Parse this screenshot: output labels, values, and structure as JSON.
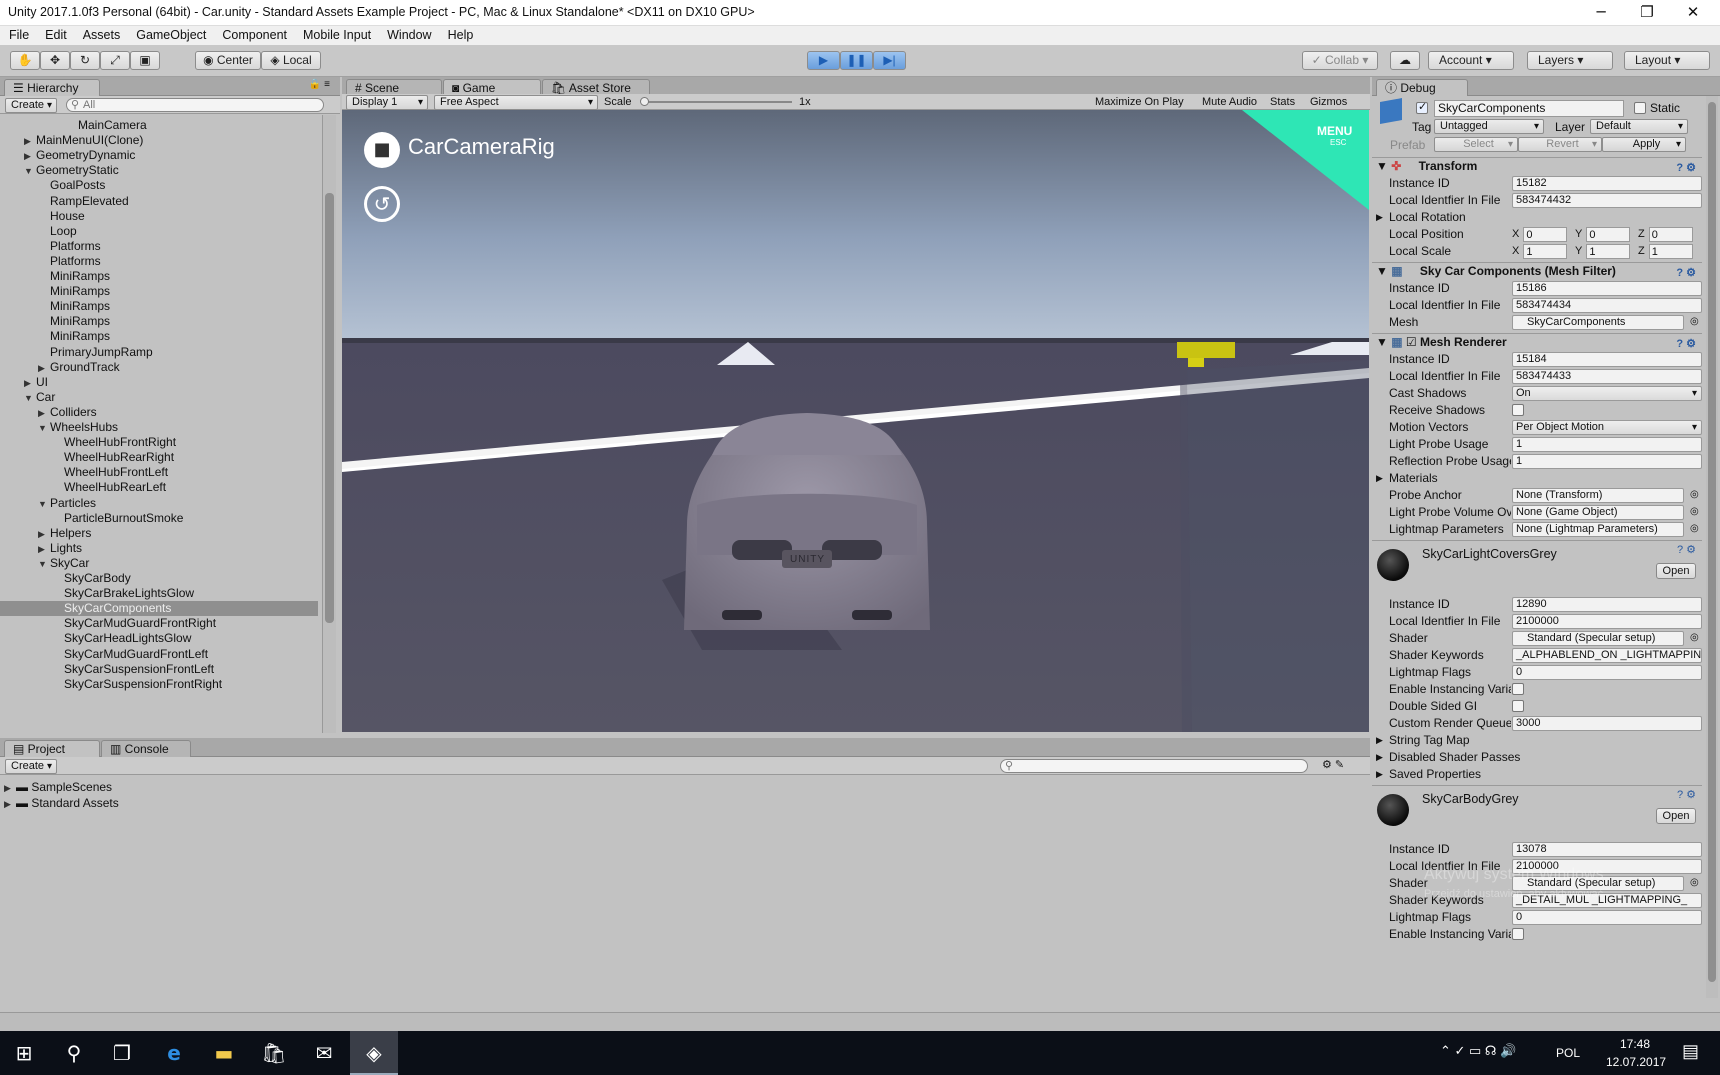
{
  "window": {
    "title": "Unity 2017.1.0f3 Personal (64bit) - Car.unity - Standard Assets Example Project - PC, Mac & Linux Standalone* <DX11 on DX10 GPU>",
    "minimize": "─",
    "maximize": "❐",
    "close": "✕"
  },
  "menu": [
    "File",
    "Edit",
    "Assets",
    "GameObject",
    "Component",
    "Mobile Input",
    "Window",
    "Help"
  ],
  "toolbar": {
    "center": "Center",
    "local": "Local",
    "collab": "Collab",
    "account": "Account",
    "layers": "Layers",
    "layout": "Layout"
  },
  "hierarchy": {
    "tab": "Hierarchy",
    "create": "Create",
    "search_placeholder": "All",
    "rows": [
      {
        "t": "MainCamera",
        "d": 4,
        "a": ""
      },
      {
        "t": "MainMenuUI(Clone)",
        "d": 1,
        "a": "▶"
      },
      {
        "t": "GeometryDynamic",
        "d": 1,
        "a": "▶"
      },
      {
        "t": "GeometryStatic",
        "d": 1,
        "a": "▼"
      },
      {
        "t": "GoalPosts",
        "d": 2,
        "a": ""
      },
      {
        "t": "RampElevated",
        "d": 2,
        "a": ""
      },
      {
        "t": "House",
        "d": 2,
        "a": ""
      },
      {
        "t": "Loop",
        "d": 2,
        "a": ""
      },
      {
        "t": "Platforms",
        "d": 2,
        "a": ""
      },
      {
        "t": "Platforms",
        "d": 2,
        "a": ""
      },
      {
        "t": "MiniRamps",
        "d": 2,
        "a": ""
      },
      {
        "t": "MiniRamps",
        "d": 2,
        "a": ""
      },
      {
        "t": "MiniRamps",
        "d": 2,
        "a": ""
      },
      {
        "t": "MiniRamps",
        "d": 2,
        "a": ""
      },
      {
        "t": "MiniRamps",
        "d": 2,
        "a": ""
      },
      {
        "t": "PrimaryJumpRamp",
        "d": 2,
        "a": ""
      },
      {
        "t": "GroundTrack",
        "d": 2,
        "a": "▶"
      },
      {
        "t": "UI",
        "d": 1,
        "a": "▶"
      },
      {
        "t": "Car",
        "d": 1,
        "a": "▼"
      },
      {
        "t": "Colliders",
        "d": 2,
        "a": "▶"
      },
      {
        "t": "WheelsHubs",
        "d": 2,
        "a": "▼"
      },
      {
        "t": "WheelHubFrontRight",
        "d": 3,
        "a": ""
      },
      {
        "t": "WheelHubRearRight",
        "d": 3,
        "a": ""
      },
      {
        "t": "WheelHubFrontLeft",
        "d": 3,
        "a": ""
      },
      {
        "t": "WheelHubRearLeft",
        "d": 3,
        "a": ""
      },
      {
        "t": "Particles",
        "d": 2,
        "a": "▼"
      },
      {
        "t": "ParticleBurnoutSmoke",
        "d": 3,
        "a": ""
      },
      {
        "t": "Helpers",
        "d": 2,
        "a": "▶"
      },
      {
        "t": "Lights",
        "d": 2,
        "a": "▶"
      },
      {
        "t": "SkyCar",
        "d": 2,
        "a": "▼"
      },
      {
        "t": "SkyCarBody",
        "d": 3,
        "a": ""
      },
      {
        "t": "SkyCarBrakeLightsGlow",
        "d": 3,
        "a": ""
      },
      {
        "t": "SkyCarComponents",
        "d": 3,
        "a": "",
        "sel": true
      },
      {
        "t": "SkyCarMudGuardFrontRight",
        "d": 3,
        "a": ""
      },
      {
        "t": "SkyCarHeadLightsGlow",
        "d": 3,
        "a": ""
      },
      {
        "t": "SkyCarMudGuardFrontLeft",
        "d": 3,
        "a": ""
      },
      {
        "t": "SkyCarSuspensionFrontLeft",
        "d": 3,
        "a": ""
      },
      {
        "t": "SkyCarSuspensionFrontRight",
        "d": 3,
        "a": ""
      }
    ]
  },
  "view_tabs": {
    "scene": "Scene",
    "game": "Game",
    "asset_store": "Asset Store"
  },
  "game_bar": {
    "display": "Display 1",
    "aspect": "Free Aspect",
    "scale_label": "Scale",
    "scale_value": "1x",
    "maximize": "Maximize On Play",
    "mute": "Mute Audio",
    "stats": "Stats",
    "gizmos": "Gizmos"
  },
  "game_view": {
    "rig_label": "CarCameraRig",
    "menu": "MENU",
    "esc": "ESC",
    "plate": "UNITY"
  },
  "project": {
    "tab_project": "Project",
    "tab_console": "Console",
    "create": "Create",
    "folders": [
      "SampleScenes",
      "Standard Assets"
    ]
  },
  "inspector": {
    "tab": "Debug",
    "object_name": "SkyCarComponents",
    "static_label": "Static",
    "tag_label": "Tag",
    "tag_value": "Untagged",
    "layer_label": "Layer",
    "layer_value": "Default",
    "prefab_label": "Prefab",
    "select": "Select",
    "revert": "Revert",
    "apply": "Apply",
    "transform": {
      "title": "Transform",
      "instance_id": "15182",
      "local_id": "583474432",
      "rotation": "Local Rotation",
      "position_label": "Local Position",
      "scale_label": "Local Scale",
      "pos": [
        "0",
        "0",
        "0"
      ],
      "scale": [
        "1",
        "1",
        "1"
      ]
    },
    "mesh_filter": {
      "title": "Sky Car Components (Mesh Filter)",
      "instance_id": "15186",
      "local_id": "583474434",
      "mesh_label": "Mesh",
      "mesh": "SkyCarComponents"
    },
    "mesh_renderer": {
      "title": "Mesh Renderer",
      "instance_id": "15184",
      "local_id": "583474433",
      "cast_shadows": "On",
      "motion_vectors": "Per Object Motion",
      "light_probe_usage": "1",
      "reflection_probe": "1",
      "probe_anchor": "None (Transform)",
      "light_probe_volume": "None (Game Object)",
      "lightmap_params": "None (Lightmap Parameters)"
    },
    "labels": {
      "instance_id": "Instance ID",
      "local_id": "Local Identfier In File",
      "cast_shadows": "Cast Shadows",
      "receive_shadows": "Receive Shadows",
      "motion_vectors": "Motion Vectors",
      "light_probe_usage": "Light Probe Usage",
      "reflection_probe": "Reflection Probe Usage",
      "materials": "Materials",
      "probe_anchor": "Probe Anchor",
      "light_probe_volume": "Light Probe Volume Override",
      "lightmap_params": "Lightmap Parameters",
      "shader": "Shader",
      "shader_keywords": "Shader Keywords",
      "lightmap_flags": "Lightmap Flags",
      "enable_instancing": "Enable Instancing Variants",
      "double_sided": "Double Sided GI",
      "custom_render_queue": "Custom Render Queue",
      "string_tag_map": "String Tag Map",
      "disabled_passes": "Disabled Shader Passes",
      "saved_props": "Saved Properties",
      "open": "Open"
    },
    "mat1": {
      "name": "SkyCarLightCoversGrey",
      "instance_id": "12890",
      "local_id": "2100000",
      "shader": "Standard (Specular setup)",
      "keywords": "_ALPHABLEND_ON _LIGHTMAPPING",
      "lightmap_flags": "0",
      "render_queue": "3000"
    },
    "mat2": {
      "name": "SkyCarBodyGrey",
      "instance_id": "13078",
      "local_id": "2100000",
      "shader": "Standard (Specular setup)",
      "keywords": "_DETAIL_MUL _LIGHTMAPPING_",
      "lightmap_flags": "0"
    },
    "watermark1": "Aktywuj system Windows",
    "watermark2": "Przejdź do ustawień, aby aktywować"
  },
  "taskbar": {
    "lang": "POL",
    "time": "17:48",
    "date": "12.07.2017"
  }
}
